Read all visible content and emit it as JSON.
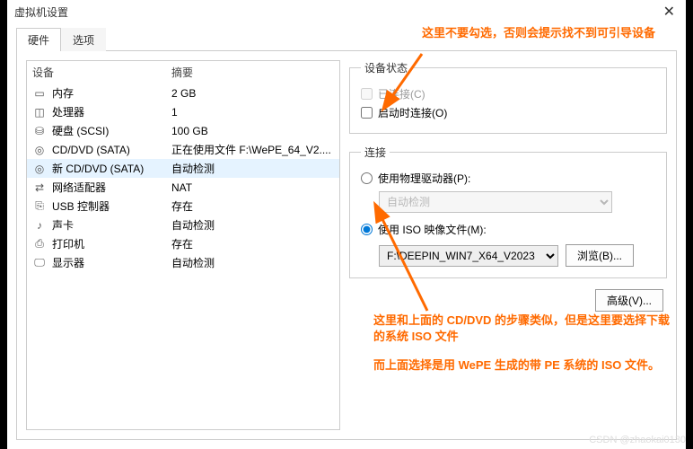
{
  "window": {
    "title": "虚拟机设置"
  },
  "tabs": {
    "hardware": "硬件",
    "options": "选项"
  },
  "list": {
    "header_device": "设备",
    "header_summary": "摘要",
    "rows": [
      {
        "icon": "memory-icon",
        "name": "内存",
        "summary": "2 GB"
      },
      {
        "icon": "cpu-icon",
        "name": "处理器",
        "summary": "1"
      },
      {
        "icon": "disk-icon",
        "name": "硬盘 (SCSI)",
        "summary": "100 GB"
      },
      {
        "icon": "cd-icon",
        "name": "CD/DVD (SATA)",
        "summary": "正在使用文件 F:\\WePE_64_V2...."
      },
      {
        "icon": "cd-icon",
        "name": "新 CD/DVD (SATA)",
        "summary": "自动检测"
      },
      {
        "icon": "net-icon",
        "name": "网络适配器",
        "summary": "NAT"
      },
      {
        "icon": "usb-icon",
        "name": "USB 控制器",
        "summary": "存在"
      },
      {
        "icon": "sound-icon",
        "name": "声卡",
        "summary": "自动检测"
      },
      {
        "icon": "printer-icon",
        "name": "打印机",
        "summary": "存在"
      },
      {
        "icon": "display-icon",
        "name": "显示器",
        "summary": "自动检测"
      }
    ]
  },
  "status": {
    "legend": "设备状态",
    "connected": "已连接(C)",
    "connect_on_power": "启动时连接(O)"
  },
  "connection": {
    "legend": "连接",
    "use_physical": "使用物理驱动器(P):",
    "auto_detect": "自动检测",
    "use_iso": "使用 ISO 映像文件(M):",
    "iso_path": "F:\\DEEPIN_WIN7_X64_V2023",
    "browse": "浏览(B)..."
  },
  "advanced": "高级(V)...",
  "annotations": {
    "top": "这里不要勾选，否则会提示找不到可引导设备",
    "mid1": "这里和上面的 CD/DVD 的步骤类似，但是这里要选择下载的系统 ISO 文件",
    "mid2": "而上面选择是用 WePE 生成的带 PE 系统的 ISO 文件。"
  },
  "watermark": "CSDN @zhaokai0130"
}
